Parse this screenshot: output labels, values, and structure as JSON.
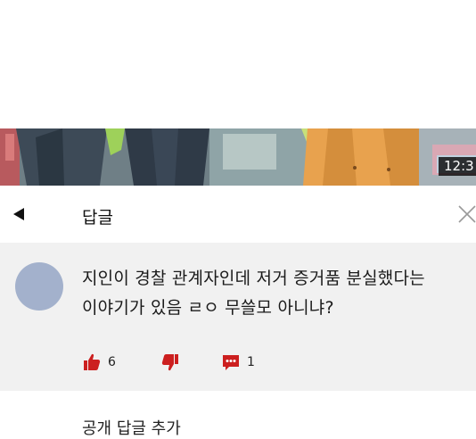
{
  "video": {
    "timestamp": "12:3"
  },
  "header": {
    "title": "답글",
    "back_icon": "back-arrow-icon",
    "close_icon": "close-icon"
  },
  "comment": {
    "text_line1": "지인이 경찰 관계자인데 저거 증거품 분실했다는",
    "text_line2": "이야기가 있음 ㄹㅇ 무쓸모 아니냐?",
    "likes": "6",
    "replies": "1",
    "accent_color": "#cc1f1f",
    "avatar_color": "#a3b1cc"
  },
  "add_reply": {
    "label": "공개 답글 추가"
  }
}
